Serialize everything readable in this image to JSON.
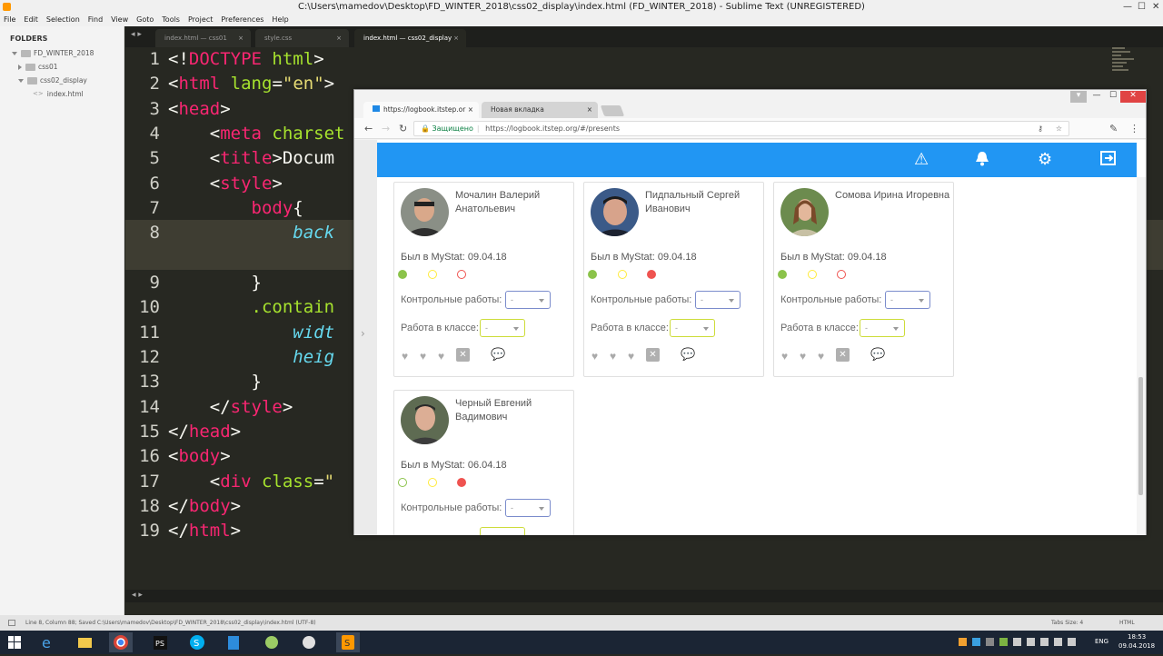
{
  "window": {
    "title": "C:\\Users\\mamedov\\Desktop\\FD_WINTER_2018\\css02_display\\index.html (FD_WINTER_2018) - Sublime Text (UNREGISTERED)",
    "minimize": "—",
    "maximize": "☐",
    "close": "✕"
  },
  "menu": [
    "File",
    "Edit",
    "Selection",
    "Find",
    "View",
    "Goto",
    "Tools",
    "Project",
    "Preferences",
    "Help"
  ],
  "sidebar": {
    "header": "FOLDERS",
    "root": "FD_WINTER_2018",
    "items": [
      {
        "label": "css01"
      },
      {
        "label": "css02_display"
      },
      {
        "label": "index.html"
      }
    ]
  },
  "tabs": [
    {
      "label": "index.html — css01",
      "close": "×"
    },
    {
      "label": "style.css",
      "close": "×"
    },
    {
      "label": "index.html — css02_display",
      "close": "×"
    }
  ],
  "editor": {
    "line_numbers": [
      "1",
      "2",
      "3",
      "4",
      "5",
      "6",
      "7",
      "8",
      "",
      "9",
      "10",
      "11",
      "12",
      "13",
      "14",
      "15",
      "16",
      "17",
      "18",
      "19"
    ]
  },
  "statusbar": {
    "left": "Line 8, Column 88; Saved C:\\Users\\mamedov\\Desktop\\FD_WINTER_2018\\css02_display\\index.html (UTF-8)",
    "tab_size": "Tabs Size: 4",
    "syntax": "HTML"
  },
  "browser": {
    "tabs": [
      {
        "label": "https://logbook.itstep.or",
        "close": "×"
      },
      {
        "label": "Новая вкладка",
        "close": "×"
      }
    ],
    "secure_label": "Защищено",
    "url": "https://logbook.itstep.org/#/presents",
    "students": [
      {
        "name": "Мочалин Валерий Анатольевич",
        "last_seen": "Был в MyStat: 09.04.18",
        "attendance": [
          "present",
          "late",
          "absent"
        ]
      },
      {
        "name": "Пидпальный Сергей Иванович",
        "last_seen": "Был в MyStat: 09.04.18",
        "attendance": [
          "present",
          "late",
          "absent-selected"
        ]
      },
      {
        "name": "Сомова Ирина Игоревна",
        "last_seen": "Был в MyStat: 09.04.18",
        "attendance": [
          "present",
          "late",
          "absent"
        ]
      },
      {
        "name": "Черный Евгений Вадимович",
        "last_seen": "Был в MyStat: 06.04.18",
        "attendance": [
          "present-outline",
          "late",
          "absent-selected"
        ]
      }
    ],
    "labels": {
      "control": "Контрольные работы:",
      "classwork": "Работа в классе:",
      "select_value": "-"
    }
  },
  "taskbar": {
    "lang": "ENG",
    "time": "18:53",
    "date": "09.04.2018"
  },
  "colors": {
    "appbar": "#2196f3",
    "present": "#8bc34a",
    "late": "#ffeb3b",
    "absent": "#ef5350"
  }
}
